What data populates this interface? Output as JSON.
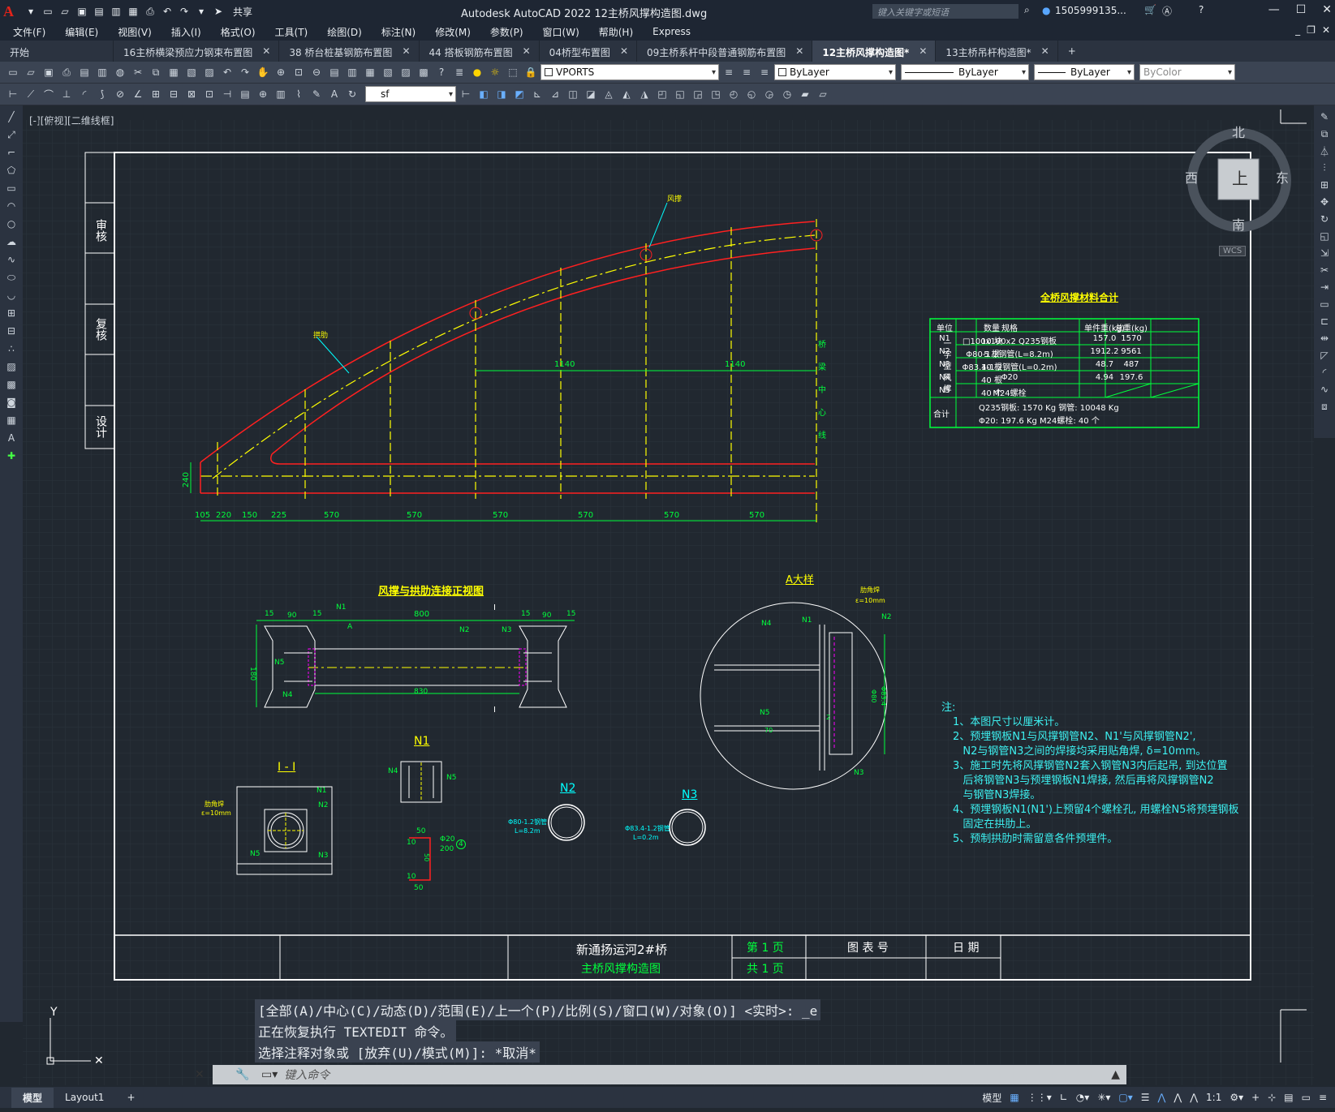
{
  "app": {
    "title": "Autodesk AutoCAD 2022    12主桥风撑构造图.dwg",
    "share": "共享",
    "search_placeholder": "键入关键字或短语",
    "user": "1505999135...",
    "logo": "A"
  },
  "menu": [
    "文件(F)",
    "编辑(E)",
    "视图(V)",
    "插入(I)",
    "格式(O)",
    "工具(T)",
    "绘图(D)",
    "标注(N)",
    "修改(M)",
    "参数(P)",
    "窗口(W)",
    "帮助(H)",
    "Express"
  ],
  "tabs": [
    {
      "label": "开始",
      "active": false,
      "closable": false
    },
    {
      "label": "16主桥横梁预应力钢束布置图",
      "active": false,
      "closable": true
    },
    {
      "label": "38 桥台桩基钢筋布置图",
      "active": false,
      "closable": true
    },
    {
      "label": "44 搭板钢筋布置图",
      "active": false,
      "closable": true
    },
    {
      "label": "04桥型布置图",
      "active": false,
      "closable": true
    },
    {
      "label": "09主桥系杆中段普通钢筋布置图",
      "active": false,
      "closable": true
    },
    {
      "label": "12主桥风撑构造图*",
      "active": true,
      "closable": true
    },
    {
      "label": "13主桥吊杆构造图*",
      "active": false,
      "closable": true
    }
  ],
  "toolbar": {
    "layer": "VPORTS",
    "color": "ByLayer",
    "linetype": "ByLayer",
    "lineweight": "ByLayer",
    "plotstyle": "ByColor",
    "textstyle": "sf"
  },
  "viewport_label": "[-][俯视][二维线框]",
  "compass": {
    "n": "北",
    "s": "南",
    "e": "东",
    "w": "西",
    "center": "上",
    "wcs": "WCS"
  },
  "drawing": {
    "sidebar": [
      "审核",
      "复核",
      "设计"
    ],
    "dims_bottom": [
      "105",
      "220",
      "150",
      "225",
      "570",
      "570",
      "570",
      "570",
      "570",
      "570"
    ],
    "dim_height": "240",
    "dims_mid": [
      "1140",
      "1140"
    ],
    "label_fengcheng": "风撑",
    "label_gonglei": "拱肋",
    "centerline": [
      "桥",
      "梁",
      "中",
      "心",
      "线"
    ],
    "detail_title": "风撑与拱肋连接正视图",
    "detail_dims": [
      "15",
      "90",
      "15",
      "800",
      "15",
      "90",
      "15",
      "830",
      "180"
    ],
    "detail_labels": [
      "N1",
      "A",
      "N2",
      "N3",
      "N5",
      "N4",
      "I",
      "I"
    ],
    "section_title": "I - I",
    "section_labels": [
      "肋角焊",
      "ε=10mm",
      "N1",
      "N2",
      "N3",
      "N5"
    ],
    "n1_title": "N1",
    "n1_labels": [
      "N4",
      "N5"
    ],
    "bolt_dims": [
      "50",
      "10",
      "Φ20",
      "200",
      "4",
      "50",
      "10",
      "50"
    ],
    "n2_title": "N2",
    "n2_label": [
      "Φ80-1.2钢管",
      "L=8.2m"
    ],
    "n3_title": "N3",
    "n3_label": [
      "Φ83.4-1.2钢管",
      "L=0.2m"
    ],
    "bigA_title": "A大样",
    "bigA_labels": [
      "肋角焊",
      "ε=10mm",
      "N2",
      "N4",
      "N1",
      "N5",
      "70",
      "N3",
      "2",
      "Φ80",
      "Φ83.4"
    ]
  },
  "material_table": {
    "title": "全桥风撑材料合计",
    "headers": [
      "单位",
      "规格",
      "数量",
      "单件重(kg)",
      "总重(kg)"
    ],
    "group": "一字型风撑",
    "rows": [
      [
        "N1",
        "□100x100x2 Q235钢板",
        "10 块",
        "157.0",
        "1570"
      ],
      [
        "N2",
        "Φ80-1.2钢管(L=8.2m)",
        "5 根",
        "1912.2",
        "9561"
      ],
      [
        "N3",
        "Φ83.4-1.2钢管(L=0.2m)",
        "10 根",
        "48.7",
        "487"
      ],
      [
        "N4",
        "Φ20",
        "40 根",
        "4.94",
        "197.6"
      ],
      [
        "N5",
        "M24螺栓",
        "40 个",
        "",
        ""
      ]
    ],
    "total_label": "合计",
    "total_lines": [
      "Q235钢板: 1570  Kg      钢管: 10048  Kg",
      "Φ20: 197.6 Kg           M24螺栓: 40 个"
    ]
  },
  "notes": {
    "title": "注:",
    "items": [
      "1、本图尺寸以厘米计。",
      "2、预埋钢板N1与风撑钢管N2、N1'与风撑钢管N2',",
      "   N2与钢管N3之间的焊接均采用贴角焊, δ=10mm。",
      "3、施工时先将风撑钢管N2套入钢管N3内后起吊, 到达位置",
      "   后将钢管N3与预埋钢板N1焊接, 然后再将风撑钢管N2",
      "   与钢管N3焊接。",
      "4、预埋钢板N1(N1')上预留4个螺栓孔, 用螺栓N5将预埋钢板",
      "   固定在拱肋上。",
      "5、预制拱肋时需留意各件预埋件。"
    ]
  },
  "titleblock": {
    "project": "新通扬运河2#桥",
    "drawing": "主桥风撑构造图",
    "page": "第 1 页",
    "total": "共 1 页",
    "chart_no": "图 表 号",
    "date": "日 期"
  },
  "command": {
    "history": [
      "[全部(A)/中心(C)/动态(D)/范围(E)/上一个(P)/比例(S)/窗口(W)/对象(O)] <实时>: _e",
      "正在恢复执行 TEXTEDIT 命令。",
      "选择注释对象或 [放弃(U)/模式(M)]: *取消*"
    ],
    "placeholder": "键入命令"
  },
  "layout_tabs": [
    "模型",
    "Layout1",
    "+"
  ],
  "status": {
    "model": "模型",
    "scale": "1:1"
  },
  "colors": {
    "red": "#ff2020",
    "yellow": "#ffff00",
    "green": "#00ff3c",
    "cyan": "#00ffff",
    "white": "#ffffff",
    "magenta": "#ff00ff"
  }
}
